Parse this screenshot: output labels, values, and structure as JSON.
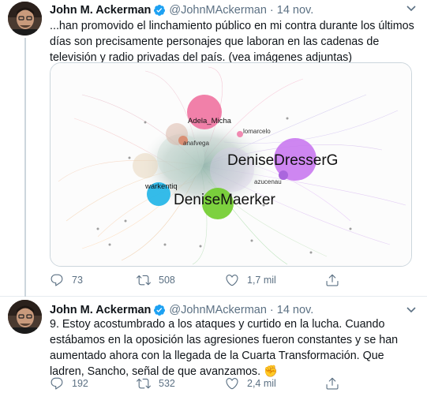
{
  "colors": {
    "verified": "#1da1f2",
    "meta": "#5b7083",
    "text": "#0f1419"
  },
  "tweets": [
    {
      "author": {
        "name": "John M. Ackerman",
        "handle": "@JohnMAckerman"
      },
      "separator": "·",
      "date": "14 nov.",
      "text": "...han promovido el linchamiento público en mi contra durante los últimos días son precisamente personajes que laboran en las cadenas de televisión y radio privadas del país. (vea imágenes adjuntas)",
      "media": {
        "labels": {
          "adela": "Adela_Micha",
          "anafvega": "anafvega",
          "dresser": "DeniseDresserG",
          "warkentin": "warkentiq",
          "maerker": "DeniseMaerker",
          "azucena": "azucenau",
          "lomarcelo": "lomarcelo"
        }
      },
      "stats": {
        "replies": "73",
        "retweets": "508",
        "likes": "1,7 mil"
      }
    },
    {
      "author": {
        "name": "John M. Ackerman",
        "handle": "@JohnMAckerman"
      },
      "separator": "·",
      "date": "14 nov.",
      "text": "9. Estoy acostumbrado a los ataques y curtido en la lucha. Cuando estábamos en la oposición las agresiones fueron constantes y se han aumentado ahora con la llegada de la Cuarta Transformación.  Que ladren, Sancho, señal de que avanzamos. ✊",
      "stats": {
        "replies": "192",
        "retweets": "532",
        "likes": "2,4 mil"
      }
    }
  ]
}
